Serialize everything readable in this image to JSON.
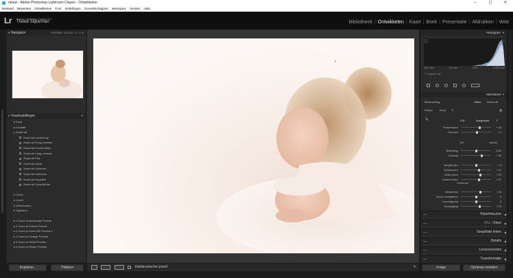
{
  "window": {
    "title": "nieuw - Adobe Photoshop Lightroom Classic - Ontwikkelen",
    "controls": [
      "–",
      "◻",
      "✕"
    ]
  },
  "menu": [
    "Bestand",
    "Bewerken",
    "Ontwikkelen",
    "Foto",
    "Instellingen",
    "Gereedschappen",
    "Weergave",
    "Venster",
    "Help"
  ],
  "identity": {
    "logo": "Lr",
    "product": "Adobe Lightroom Classic CC",
    "user": "Thekie Slijkerman"
  },
  "modules": [
    {
      "label": "Bibliotheek"
    },
    {
      "label": "Ontwikkelen"
    },
    {
      "label": "Kaart"
    },
    {
      "label": "Boek"
    },
    {
      "label": "Presentatie"
    },
    {
      "label": "Afdrukken"
    },
    {
      "label": "Web"
    }
  ],
  "navigator": {
    "title": "Navigator",
    "zoom_fit": "PASSEND",
    "zoom_fill": "VULLEN",
    "zoom_1": "1:1",
    "zoom_custom": "1:16"
  },
  "presets": {
    "title": "Voorinstellingen",
    "items": [
      {
        "label": "Kleur",
        "level": 0
      },
      {
        "label": "Creatief",
        "level": 0
      },
      {
        "label": "Zwart-wit",
        "level": 0
      },
      {
        "label": "Zwart-wit Landschap",
        "level": 1
      },
      {
        "label": "Zwart-wit Hoog contrast",
        "level": 1
      },
      {
        "label": "Zwart-wit Doordrukken",
        "level": 1
      },
      {
        "label": "Zwart-wit Laag contrast",
        "level": 1
      },
      {
        "label": "Zwart-wit Plat",
        "level": 1
      },
      {
        "label": "Zwart-wit Zacht",
        "level": 1
      },
      {
        "label": "Zwart-wit Infrarood",
        "level": 1
      },
      {
        "label": "Zwart-wit Selenium",
        "level": 1
      },
      {
        "label": "Zwart-wit Sepiatint",
        "level": 1
      },
      {
        "label": "Zwart-wit Gesplitst tint",
        "level": 1
      },
      {
        "label": "",
        "level": 0
      },
      {
        "label": "Curve",
        "level": 0
      },
      {
        "label": "Korrel",
        "level": 0
      },
      {
        "label": "Verscherpen",
        "level": 0
      },
      {
        "label": "Vignetten",
        "level": 0
      },
      {
        "label": "",
        "level": 0
      },
      {
        "label": "1 Zoom.nl landschap Presets",
        "level": 0
      },
      {
        "label": "2 Zoom.nl Portret Presets",
        "level": 0
      },
      {
        "label": "3 Zoom.nl Zwart-Wit Presets 1",
        "level": 0
      },
      {
        "label": "4 Zoom.nl Vintage Presets",
        "level": 0
      },
      {
        "label": "5 Zoom.nl Herfst Presets",
        "level": 0
      },
      {
        "label": "6 Zoom.nl Winter Presets",
        "level": 0
      }
    ]
  },
  "left_buttons": {
    "copy": "Kopiëren...",
    "paste": "Plakken"
  },
  "toolbar": {
    "softproof": "Elektronische proef"
  },
  "histogram": {
    "title": "Histogram",
    "iso": "ISO 100",
    "focal": "24 mm",
    "aperture": "f/2,5",
    "shutter": "1/125 sec",
    "original": "Originele foto"
  },
  "basic": {
    "title": "Standaard",
    "treatment_label": "Behandeling:",
    "treatment_color": "Kleur",
    "treatment_bw": "Zwart-wit",
    "profile_label": "Profiel:",
    "profile_value": "Kleur",
    "wb_label": "WB:",
    "wb_value": "Aangepast",
    "tone_label": "Tint",
    "tone_auto": "Autom.",
    "presence_label": "Presence",
    "sliders": [
      {
        "label": "Temperatuur",
        "value": "+ 16",
        "pos": 0.62
      },
      {
        "label": "Kleurtint",
        "value": "+ 4",
        "pos": 0.53
      },
      {
        "label": "Belichting",
        "value": "0,00",
        "pos": 0.5
      },
      {
        "label": "Contrast",
        "value": "+ 40",
        "pos": 0.7
      },
      {
        "label": "Hooglichten",
        "value": "+ 4",
        "pos": 0.52
      },
      {
        "label": "Schaduwen",
        "value": "+ 21",
        "pos": 0.6
      },
      {
        "label": "Witte tinten",
        "value": "+ 29",
        "pos": 0.64
      },
      {
        "label": "Zwarte tinten",
        "value": "+ 19",
        "pos": 0.6
      },
      {
        "label": "Helderheid",
        "value": "+ 28",
        "pos": 0.64
      },
      {
        "label": "Nevel verwijderen",
        "value": "0",
        "pos": 0.5
      },
      {
        "label": "Levendigheid",
        "value": "0",
        "pos": 0.5
      },
      {
        "label": "Verzadiging",
        "value": "+ 23",
        "pos": 0.62
      }
    ]
  },
  "sections": [
    {
      "label": "Kleurtintcurve",
      "left": ""
    },
    {
      "label": "Kleur",
      "left": "HSL /"
    },
    {
      "label": "Gesplitste tinten",
      "left": ""
    },
    {
      "label": "Details",
      "left": ""
    },
    {
      "label": "Lenscorrecties",
      "left": ""
    },
    {
      "label": "Transformatie",
      "left": ""
    }
  ],
  "right_buttons": {
    "previous": "Vorige",
    "reset": "Opnieuw instellen"
  },
  "colors": {
    "accent": "#f0f0f0",
    "panel": "#2b2b2b",
    "background": "#1c1c1c"
  }
}
